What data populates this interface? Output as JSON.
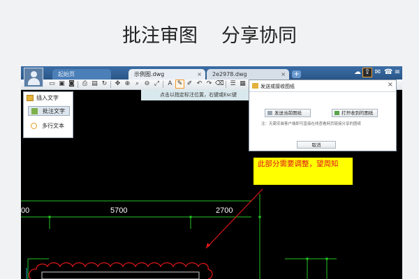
{
  "headline": {
    "part1": "批注审图",
    "part2": "分享协同"
  },
  "tabs": [
    {
      "label": "起始页",
      "state": "inactive"
    },
    {
      "label": "示例图.dwg",
      "state": "active"
    },
    {
      "label": "2e2978.dwg",
      "state": "faded"
    }
  ],
  "hint_bar": {
    "text": "点击以指定标注位置，右键或Esc键"
  },
  "insert_panel": {
    "title": "插入文字",
    "items": [
      {
        "label": "批注文字",
        "selected": true
      },
      {
        "label": "多行文本",
        "selected": false
      }
    ]
  },
  "dialog": {
    "title": "发送或接收图纸",
    "send_button": "发送当前图纸",
    "open_button": "打开收到的图纸",
    "note": "注：无需安装客户端即可直接在线查看网页链接分享的图纸",
    "cancel_button": "取消"
  },
  "annotation": {
    "text": "此部分需要调整，望周知"
  },
  "dimensions": {
    "left": "00",
    "middle": "5700",
    "right": "2700"
  },
  "colors": {
    "cad_background": "#000000",
    "dimension_green": "#23c423",
    "cloud_red": "#e01818",
    "note_yellow": "#ffff00",
    "highlight": "#f29a2e"
  }
}
